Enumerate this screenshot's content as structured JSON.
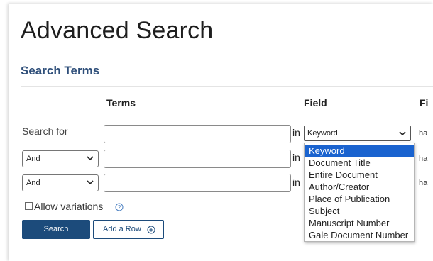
{
  "page": {
    "title": "Advanced Search",
    "section_title": "Search Terms"
  },
  "columns": {
    "terms": "Terms",
    "field": "Field",
    "truncated": "Fi"
  },
  "rows": [
    {
      "label": "Search for",
      "term_value": "",
      "in_label": "in",
      "field_value": "Keyword",
      "trailing": "ha"
    },
    {
      "operator": "And",
      "term_value": "",
      "in_label": "in",
      "trailing": "ha"
    },
    {
      "operator": "And",
      "term_value": "",
      "in_label": "in",
      "trailing": "ha"
    }
  ],
  "field_dropdown": {
    "options": [
      "Keyword",
      "Document Title",
      "Entire Document",
      "Author/Creator",
      "Place of Publication",
      "Subject",
      "Manuscript Number",
      "Gale Document Number"
    ],
    "selected": "Keyword"
  },
  "options": {
    "allow_variations": "Allow variations",
    "allow_variations_checked": false
  },
  "buttons": {
    "search": "Search",
    "add_row": "Add a Row"
  },
  "colors": {
    "accent": "#1c4b7b",
    "section_title": "#2f4f7a",
    "dropdown_highlight": "#1a63cf",
    "help_icon": "#4a7fc1"
  },
  "icons": {
    "select_chevron": "chevron-down-icon",
    "help": "question-circle-icon",
    "add": "plus-circle-icon"
  }
}
